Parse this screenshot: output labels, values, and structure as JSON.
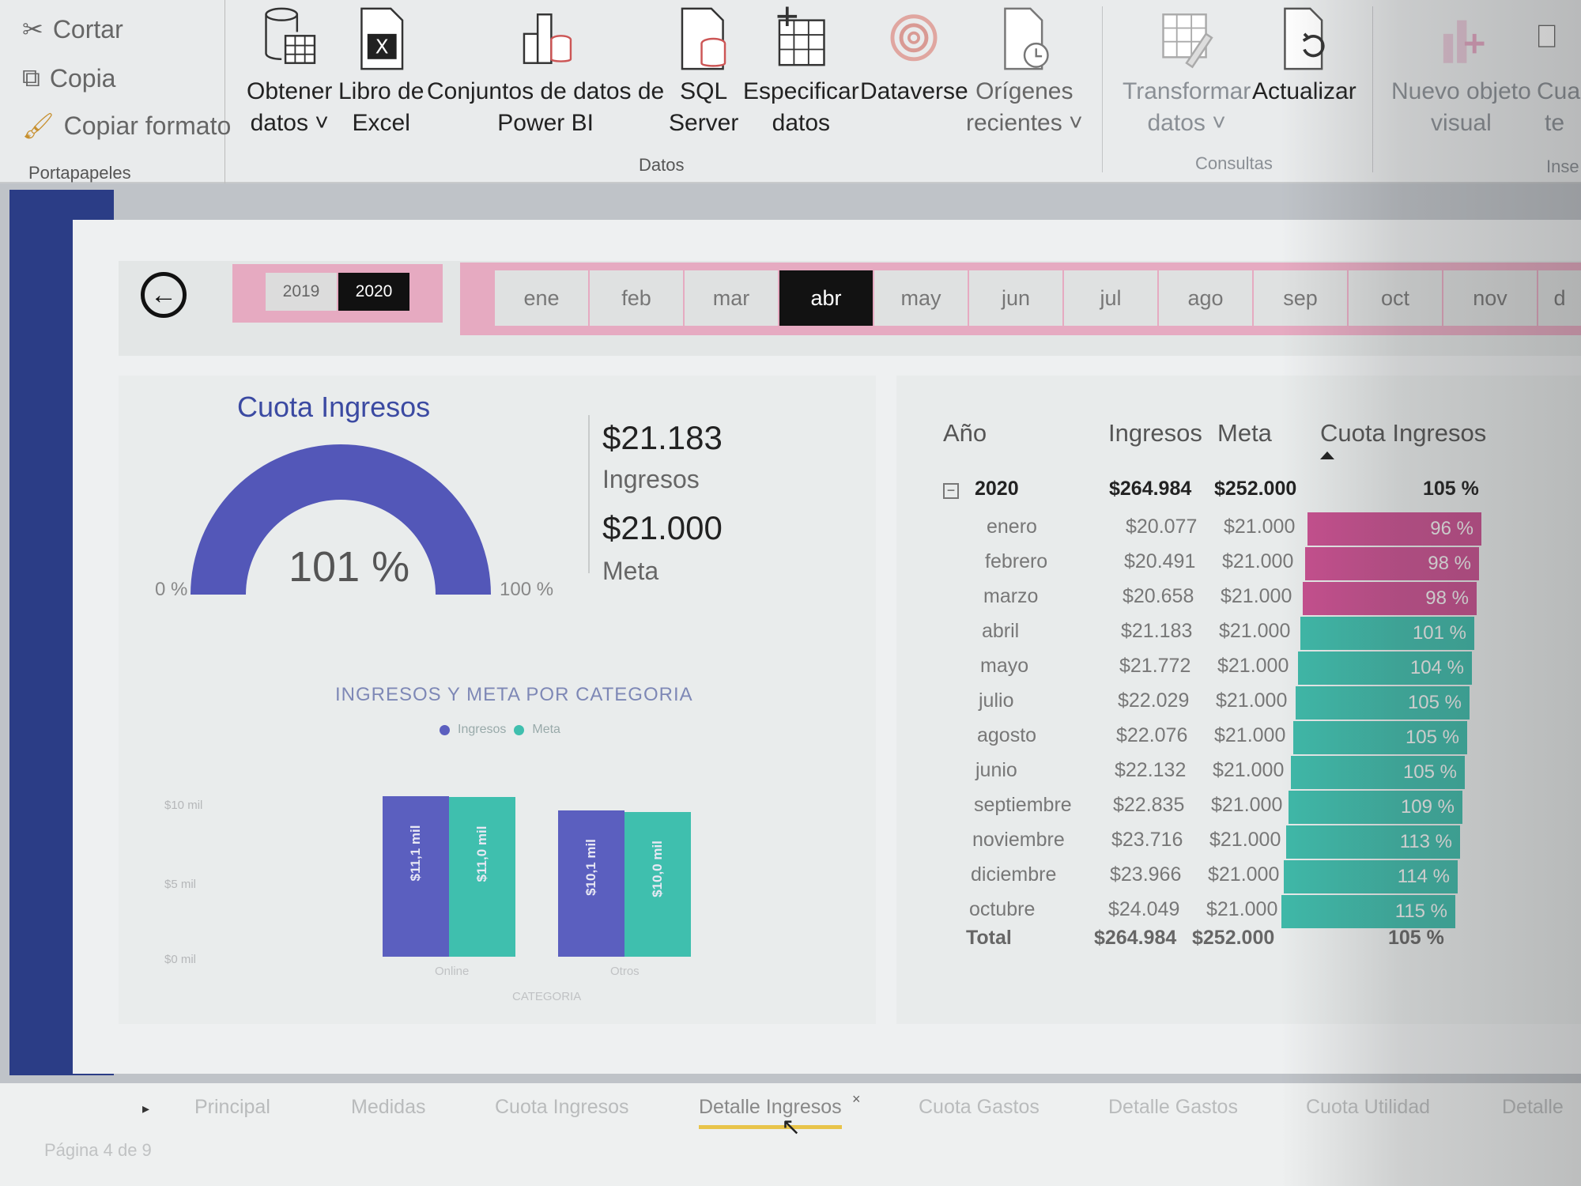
{
  "ribbon": {
    "clipboard": {
      "cut": "Cortar",
      "copy": "Copia",
      "format_painter": "Copiar formato",
      "group": "Portapapeles"
    },
    "data_buttons": [
      {
        "line1": "Obtener",
        "line2": "datos ˅"
      },
      {
        "line1": "Libro de",
        "line2": "Excel"
      },
      {
        "line1": "Conjuntos de datos de",
        "line2": "Power BI"
      },
      {
        "line1": "SQL",
        "line2": "Server"
      },
      {
        "line1": "Especificar",
        "line2": "datos"
      },
      {
        "line1": "Dataverse",
        "line2": ""
      },
      {
        "line1": "Orígenes",
        "line2": "recientes ˅"
      }
    ],
    "data_group": "Datos",
    "query_buttons": [
      {
        "line1": "Transformar",
        "line2": "datos ˅"
      },
      {
        "line1": "Actualizar",
        "line2": ""
      }
    ],
    "query_group": "Consultas",
    "insert_buttons": [
      {
        "line1": "Nuevo objeto",
        "line2": "visual"
      },
      {
        "line1": "Cua",
        "line2": "te"
      }
    ],
    "insert_group": "Inse"
  },
  "slicers": {
    "years": [
      "2019",
      "2020"
    ],
    "selected_year": "2020",
    "months": [
      "ene",
      "feb",
      "mar",
      "abr",
      "may",
      "jun",
      "jul",
      "ago",
      "sep",
      "oct",
      "nov",
      "d"
    ],
    "selected_month": "abr"
  },
  "gauge": {
    "title": "Cuota Ingresos",
    "value_label": "101 %",
    "value": 1.01,
    "min_label": "0 %",
    "max_label": "100 %"
  },
  "kpi": {
    "ingresos_value": "$21.183",
    "ingresos_label": "Ingresos",
    "meta_value": "$21.000",
    "meta_label": "Meta"
  },
  "chart_data": {
    "type": "bar",
    "title": "INGRESOS Y META POR CATEGORIA",
    "xlabel": "CATEGORIA",
    "ylabel": "",
    "categories": [
      "Online",
      "Otros"
    ],
    "series": [
      {
        "name": "Ingresos",
        "values": [
          11.1,
          10.1
        ],
        "labels": [
          "$11,1 mil",
          "$10,1 mil"
        ],
        "color": "#5b5fbf"
      },
      {
        "name": "Meta",
        "values": [
          11.0,
          10.0
        ],
        "labels": [
          "$11,0 mil",
          "$10,0 mil"
        ],
        "color": "#3fbfae"
      }
    ],
    "yticks": [
      "$10 mil",
      "$5 mil",
      "$0 mil"
    ],
    "ylim": [
      0,
      12
    ]
  },
  "table": {
    "headers": {
      "year": "Año",
      "ingresos": "Ingresos",
      "meta": "Meta",
      "cuota": "Cuota Ingresos"
    },
    "group": {
      "label": "2020",
      "ingresos": "$264.984",
      "meta": "$252.000",
      "cuota": "105 %"
    },
    "rows": [
      {
        "mes": "enero",
        "ingresos": "$20.077",
        "meta": "$21.000",
        "cuota": "96 %",
        "pct": 96
      },
      {
        "mes": "febrero",
        "ingresos": "$20.491",
        "meta": "$21.000",
        "cuota": "98 %",
        "pct": 98
      },
      {
        "mes": "marzo",
        "ingresos": "$20.658",
        "meta": "$21.000",
        "cuota": "98 %",
        "pct": 98
      },
      {
        "mes": "abril",
        "ingresos": "$21.183",
        "meta": "$21.000",
        "cuota": "101 %",
        "pct": 101
      },
      {
        "mes": "mayo",
        "ingresos": "$21.772",
        "meta": "$21.000",
        "cuota": "104 %",
        "pct": 104
      },
      {
        "mes": "julio",
        "ingresos": "$22.029",
        "meta": "$21.000",
        "cuota": "105 %",
        "pct": 105
      },
      {
        "mes": "agosto",
        "ingresos": "$22.076",
        "meta": "$21.000",
        "cuota": "105 %",
        "pct": 105
      },
      {
        "mes": "junio",
        "ingresos": "$22.132",
        "meta": "$21.000",
        "cuota": "105 %",
        "pct": 105
      },
      {
        "mes": "septiembre",
        "ingresos": "$22.835",
        "meta": "$21.000",
        "cuota": "109 %",
        "pct": 109
      },
      {
        "mes": "noviembre",
        "ingresos": "$23.716",
        "meta": "$21.000",
        "cuota": "113 %",
        "pct": 113
      },
      {
        "mes": "diciembre",
        "ingresos": "$23.966",
        "meta": "$21.000",
        "cuota": "114 %",
        "pct": 114
      },
      {
        "mes": "octubre",
        "ingresos": "$24.049",
        "meta": "$21.000",
        "cuota": "115 %",
        "pct": 115
      }
    ],
    "total": {
      "label": "Total",
      "ingresos": "$264.984",
      "meta": "$252.000",
      "cuota": "105 %"
    },
    "colors": {
      "below": "#c6508f",
      "above": "#3fb8a8"
    }
  },
  "tabs": {
    "items": [
      "Principal",
      "Medidas",
      "Cuota Ingresos",
      "Detalle Ingresos",
      "Cuota Gastos",
      "Detalle Gastos",
      "Cuota Utilidad",
      "Detalle"
    ],
    "active": "Detalle Ingresos",
    "page_indicator": "Página 4 de 9"
  }
}
